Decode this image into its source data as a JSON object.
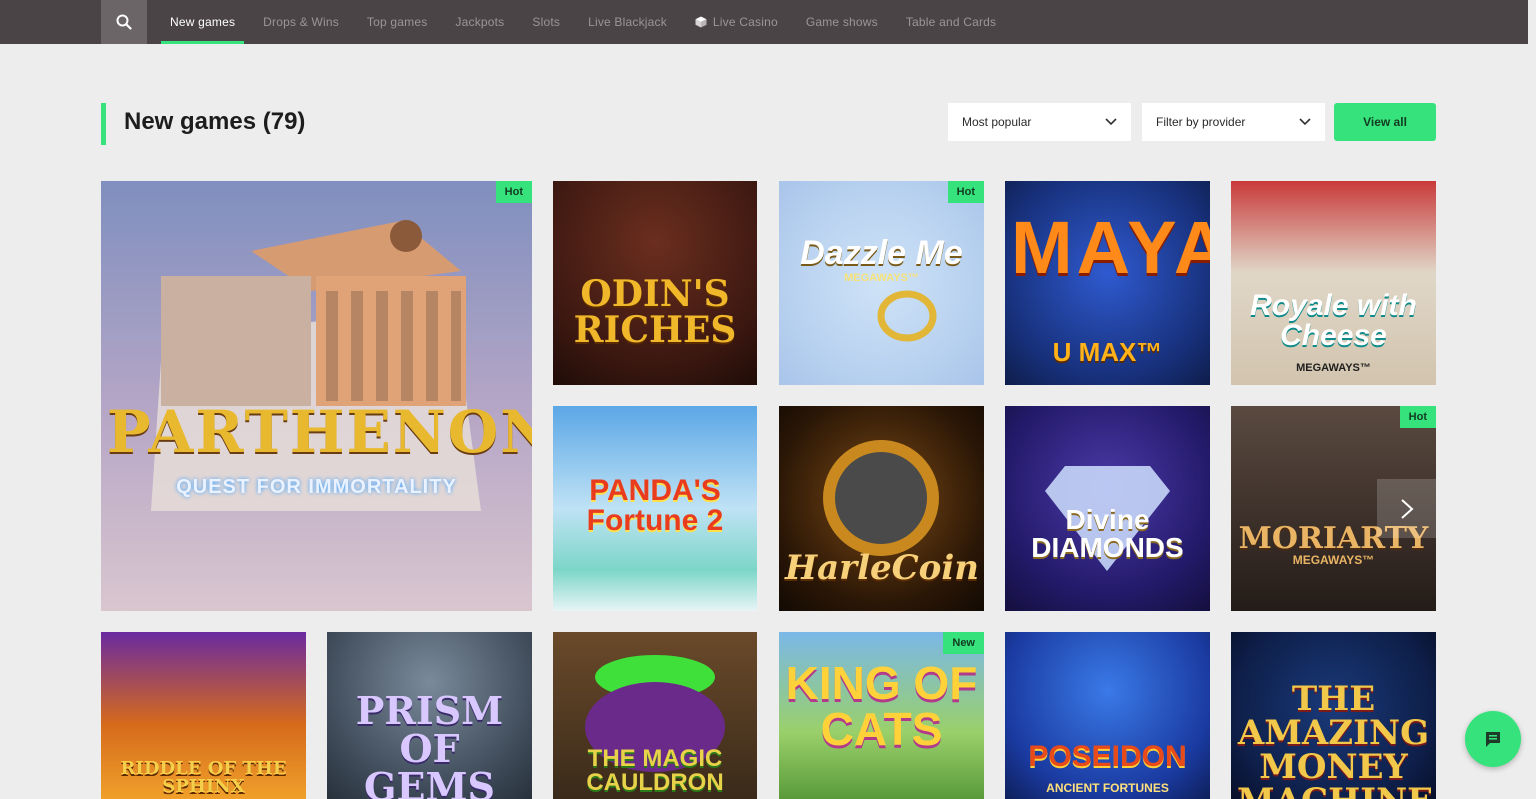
{
  "nav": {
    "tabs": [
      {
        "label": "New games",
        "active": true
      },
      {
        "label": "Drops & Wins"
      },
      {
        "label": "Top games"
      },
      {
        "label": "Jackpots"
      },
      {
        "label": "Slots"
      },
      {
        "label": "Live Blackjack"
      },
      {
        "label": "Live Casino",
        "icon": "cube-icon"
      },
      {
        "label": "Game shows"
      },
      {
        "label": "Table and Cards"
      }
    ]
  },
  "section": {
    "title": "New games (79)",
    "sort_value": "Most popular",
    "provider_value": "Filter by provider",
    "view_all_label": "View all"
  },
  "games": [
    {
      "name": "PARTHENON",
      "subtitle": "QUEST FOR IMMORTALITY",
      "badge": "Hot"
    },
    {
      "name": "ODIN'S RICHES",
      "badge": ""
    },
    {
      "name": "Dazzle Me",
      "subtitle": "MEGAWAYS™",
      "badge": "Hot"
    },
    {
      "name": "MAYA",
      "subtitle": "U MAX™",
      "badge": ""
    },
    {
      "name": "Royale with Cheese",
      "subtitle": "MEGAWAYS™",
      "badge": ""
    },
    {
      "name": "PANDA'S Fortune 2",
      "badge": ""
    },
    {
      "name": "HarleCoin",
      "badge": ""
    },
    {
      "name": "Divine DIAMONDS",
      "badge": ""
    },
    {
      "name": "MORIARTY",
      "subtitle": "MEGAWAYS™",
      "badge": "Hot"
    },
    {
      "name": "RIDDLE OF THE SPHINX",
      "badge": ""
    },
    {
      "name": "PRISM OF GEMS",
      "badge": ""
    },
    {
      "name": "THE MAGIC CAULDRON",
      "badge": ""
    },
    {
      "name": "KING OF CATS",
      "badge": "New"
    },
    {
      "name": "POSEIDON",
      "subtitle": "ANCIENT FORTUNES",
      "badge": ""
    },
    {
      "name": "THE AMAZING MONEY MACHINE",
      "badge": ""
    }
  ],
  "colors": {
    "accent": "#35e27b",
    "nav_bg": "#4a4447",
    "page_bg": "#ededed"
  }
}
